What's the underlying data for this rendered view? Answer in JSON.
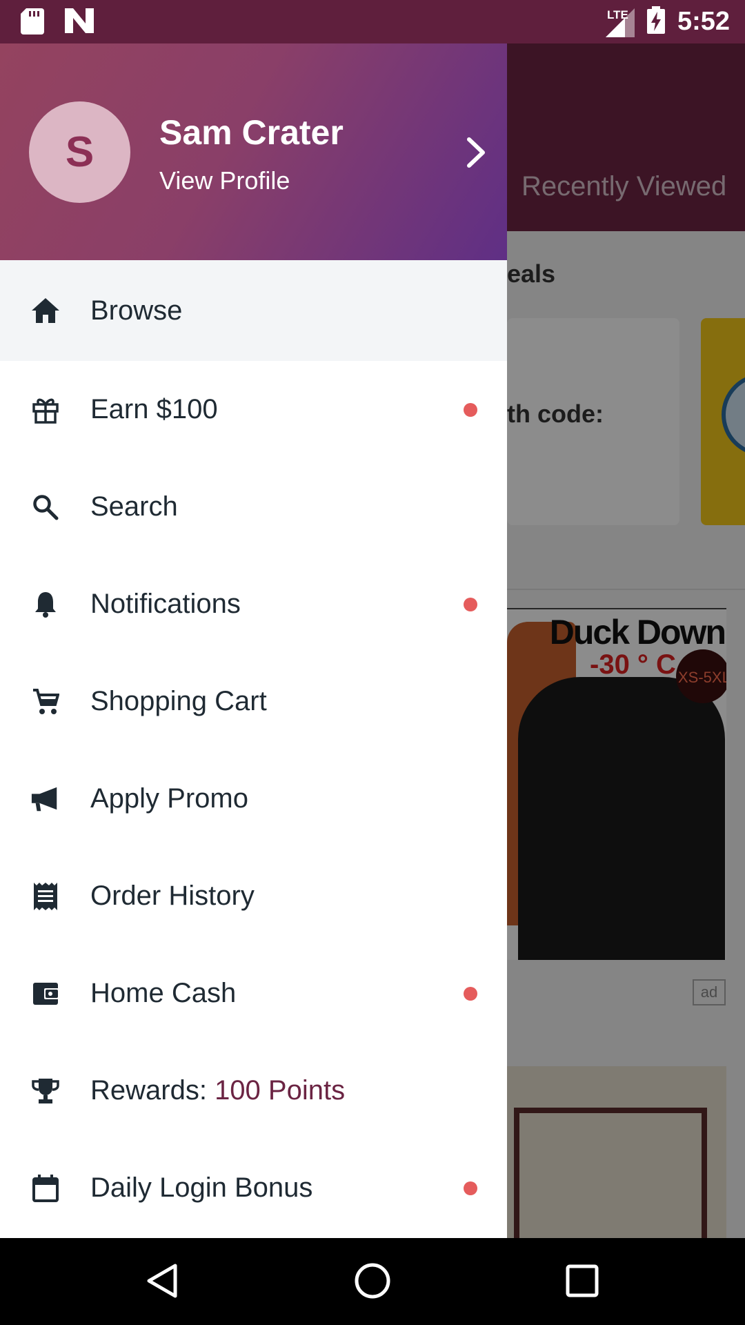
{
  "status_bar": {
    "time": "5:52",
    "network": "LTE"
  },
  "background_app": {
    "tab_recently_viewed": "Recently Viewed",
    "section_deals": "eals",
    "promo_text": "th code:",
    "product_title": "Duck Down",
    "product_temp": "-30 ° C",
    "product_sizes": "XS-5XL",
    "ad_badge": "ad"
  },
  "drawer": {
    "user": {
      "initial": "S",
      "name": "Sam Crater",
      "subtitle": "View Profile"
    },
    "items": [
      {
        "label": "Browse",
        "icon": "home-icon",
        "dot": false
      },
      {
        "label": "Earn $100",
        "icon": "gift-icon",
        "dot": true
      },
      {
        "label": "Search",
        "icon": "search-icon",
        "dot": false
      },
      {
        "label": "Notifications",
        "icon": "bell-icon",
        "dot": true
      },
      {
        "label": "Shopping Cart",
        "icon": "cart-icon",
        "dot": false
      },
      {
        "label": "Apply Promo",
        "icon": "megaphone-icon",
        "dot": false
      },
      {
        "label": "Order History",
        "icon": "receipt-icon",
        "dot": false
      },
      {
        "label": "Home Cash",
        "icon": "wallet-icon",
        "dot": true
      },
      {
        "label": "Rewards: ",
        "label_accent": "100 Points",
        "icon": "trophy-icon",
        "dot": false
      },
      {
        "label": "Daily Login Bonus",
        "icon": "calendar-icon",
        "dot": true
      }
    ]
  },
  "colors": {
    "status_bar": "#5f1f3d",
    "accent": "#6b2443",
    "dot": "#e55c5c",
    "active_row": "#f3f5f7"
  }
}
